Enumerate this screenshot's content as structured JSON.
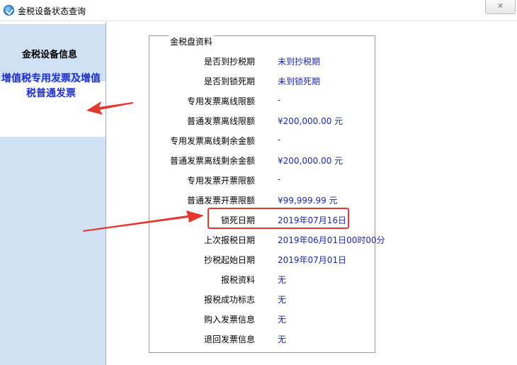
{
  "window": {
    "title": "金税设备状态查询",
    "close_label": "✕"
  },
  "sidebar": {
    "nav_item_label": "金税设备信息"
  },
  "annotation": {
    "text": "增值税专用发票及增值税普通发票"
  },
  "panel": {
    "group_title": "金税盘资料",
    "rows": [
      {
        "label": "是否到抄税期",
        "value": "未到抄税期"
      },
      {
        "label": "是否到锁死期",
        "value": "未到锁死期"
      },
      {
        "label": "专用发票离线限额",
        "value": "-"
      },
      {
        "label": "普通发票离线限额",
        "value": "¥200,000.00 元"
      },
      {
        "label": "专用发票离线剩余金额",
        "value": "-"
      },
      {
        "label": "普通发票离线剩余金额",
        "value": "¥200,000.00 元"
      },
      {
        "label": "专用发票开票限额",
        "value": "-"
      },
      {
        "label": "普通发票开票限额",
        "value": "¥99,999.99 元"
      },
      {
        "label": "锁死日期",
        "value": "2019年07月16日"
      },
      {
        "label": "上次报税日期",
        "value": "2019年06月01日00时00分"
      },
      {
        "label": "抄税起始日期",
        "value": "2019年07月01日"
      },
      {
        "label": "报税资料",
        "value": "无"
      },
      {
        "label": "报税成功标志",
        "value": "无"
      },
      {
        "label": "购入发票信息",
        "value": "无"
      },
      {
        "label": "退回发票信息",
        "value": "无"
      }
    ]
  },
  "colors": {
    "accent_blue": "#1a2a9c",
    "annotation_blue": "#1f2ec9",
    "highlight_red": "#e03a2f",
    "sidebar_bg": "#cfe1f3"
  }
}
